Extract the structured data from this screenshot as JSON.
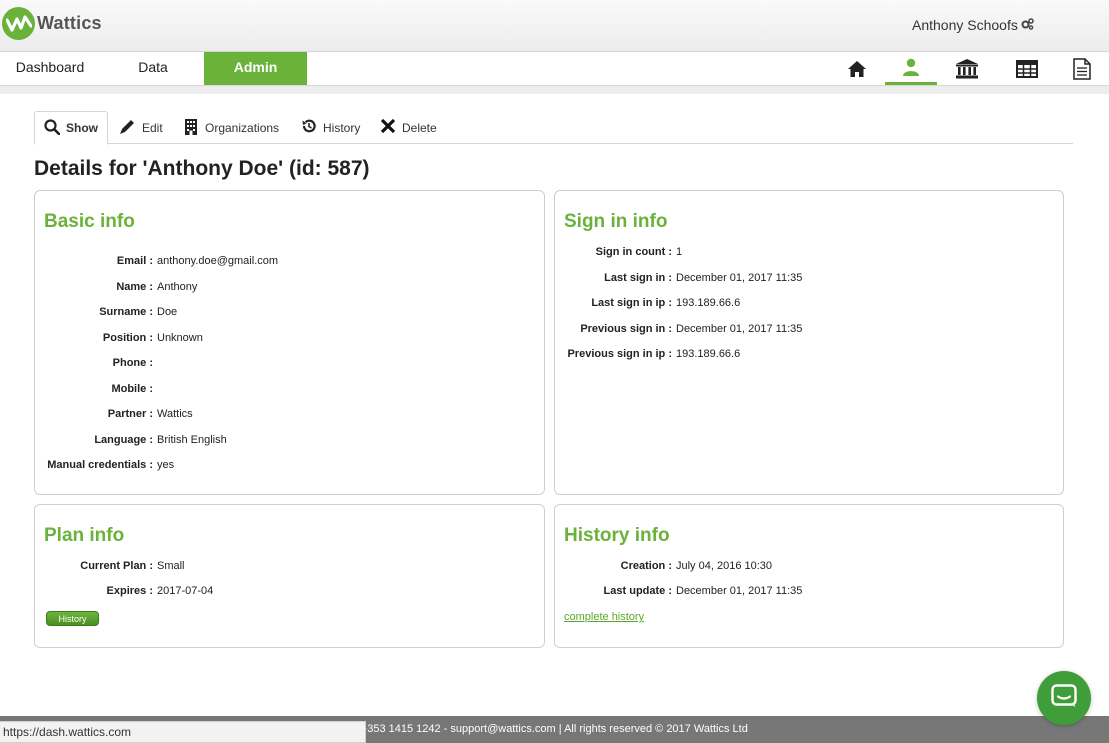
{
  "header": {
    "logo_text": "Wattics",
    "user_name": "Anthony Schoofs",
    "user_icon": "gears-icon"
  },
  "nav": {
    "tabs": [
      {
        "label": "Dashboard",
        "active": false
      },
      {
        "label": "Data",
        "active": false
      },
      {
        "label": "Admin",
        "active": true
      }
    ],
    "icons": [
      "home-icon",
      "user-icon",
      "bank-icon",
      "table-icon",
      "document-icon"
    ],
    "active_icon": "user-icon"
  },
  "subtabs": [
    {
      "label": "Show",
      "icon": "search-icon",
      "active": true
    },
    {
      "label": "Edit",
      "icon": "pencil-icon",
      "active": false
    },
    {
      "label": "Organizations",
      "icon": "building-icon",
      "active": false
    },
    {
      "label": "History",
      "icon": "history-icon",
      "active": false
    },
    {
      "label": "Delete",
      "icon": "x-icon",
      "active": false
    }
  ],
  "page_title": "Details for 'Anthony Doe' (id: 587)",
  "basic_info": {
    "title": "Basic info",
    "rows": [
      {
        "label": "Email :",
        "value": "anthony.doe@gmail.com"
      },
      {
        "label": "Name :",
        "value": "Anthony"
      },
      {
        "label": "Surname :",
        "value": "Doe"
      },
      {
        "label": "Position :",
        "value": "Unknown"
      },
      {
        "label": "Phone :",
        "value": ""
      },
      {
        "label": "Mobile :",
        "value": ""
      },
      {
        "label": "Partner :",
        "value": "Wattics"
      },
      {
        "label": "Language :",
        "value": "British English"
      },
      {
        "label": "Manual credentials :",
        "value": "yes"
      }
    ]
  },
  "sign_in_info": {
    "title": "Sign in info",
    "rows": [
      {
        "label": "Sign in count :",
        "value": "1"
      },
      {
        "label": "Last sign in :",
        "value": "December 01, 2017 11:35"
      },
      {
        "label": "Last sign in ip :",
        "value": "193.189.66.6"
      },
      {
        "label": "Previous sign in :",
        "value": "December 01, 2017 11:35"
      },
      {
        "label": "Previous sign in ip :",
        "value": "193.189.66.6"
      }
    ]
  },
  "plan_info": {
    "title": "Plan info",
    "rows": [
      {
        "label": "Current Plan :",
        "value": "Small"
      },
      {
        "label": "Expires :",
        "value": "2017-07-04"
      }
    ],
    "button_label": "History"
  },
  "history_info": {
    "title": "History info",
    "rows": [
      {
        "label": "Creation :",
        "value": "July 04, 2016 10:30"
      },
      {
        "label": "Last update :",
        "value": "December 01, 2017 11:35"
      }
    ],
    "link_label": "complete history"
  },
  "footer": {
    "text": "act: +353 1415 1242 - support@wattics.com | All rights reserved © 2017 Wattics Ltd"
  },
  "status_url": "https://dash.wattics.com",
  "colors": {
    "brand_green": "#6ab23a",
    "chat_green": "#3f9d3a",
    "footer_gray": "#777777"
  }
}
